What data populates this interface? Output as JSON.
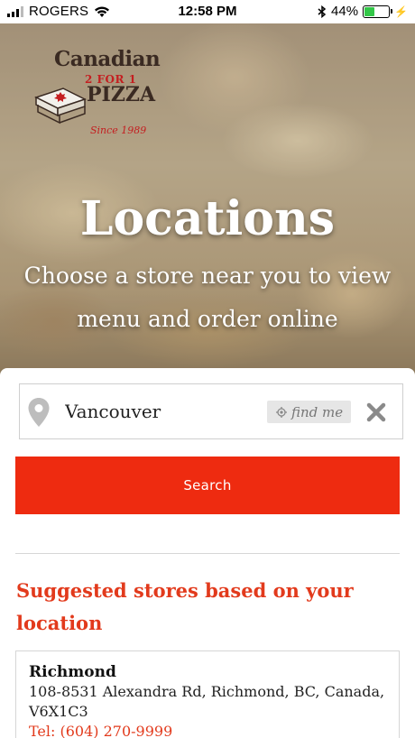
{
  "status_bar": {
    "carrier": "ROGERS",
    "time": "12:58 PM",
    "battery": "44%",
    "battery_level": 0.44,
    "battery_color": "#33c748"
  },
  "logo": {
    "line1": "Canadian",
    "line2": "2 FOR 1",
    "line3": "PIZZA",
    "line4": "Since 1989"
  },
  "hero": {
    "title": "Locations",
    "subtitle": "Choose a store near you to view menu and order online"
  },
  "search": {
    "value": "Vancouver",
    "find_me_label": "find me",
    "button_label": "Search"
  },
  "suggested": {
    "heading": "Suggested stores based on your location",
    "stores": [
      {
        "name": "Richmond",
        "address": "108-8531 Alexandra Rd, Richmond, BC, Canada, V6X1C3",
        "phone": "Tel: (604) 270-9999"
      }
    ]
  },
  "colors": {
    "accent": "#ee2b10",
    "heading": "#e23a1c"
  },
  "icons": [
    "signal-icon",
    "wifi-icon",
    "bluetooth-icon",
    "battery-icon",
    "charging-icon",
    "location-pin-icon",
    "crosshair-icon",
    "close-icon"
  ]
}
